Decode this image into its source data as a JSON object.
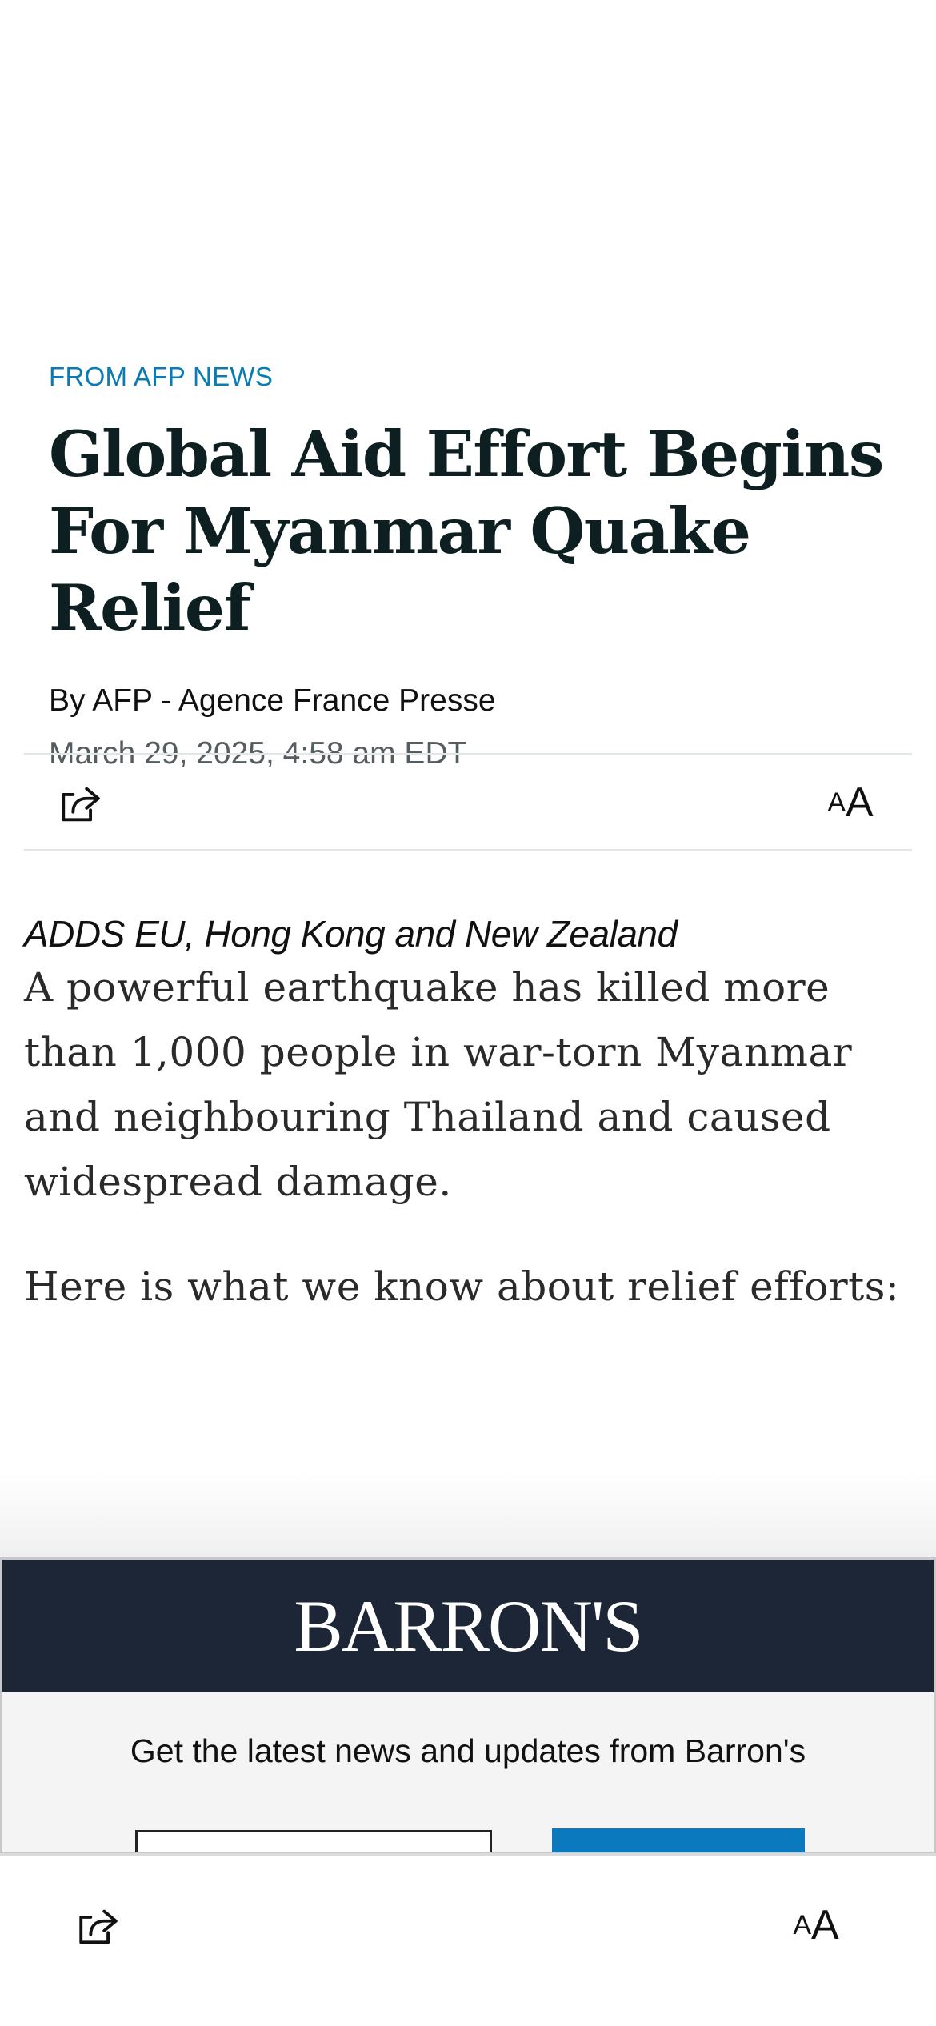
{
  "article": {
    "kicker": "FROM AFP NEWS",
    "headline": "Global Aid Effort Begins For Myanmar Quake Relief",
    "byline": "By AFP - Agence France Presse",
    "dateline": "March 29, 2025, 4:58 am EDT",
    "dek": "ADDS EU, Hong Kong and New Zealand",
    "paragraphs": [
      "A powerful earthquake has killed more than 1,000 people in war-torn Myanmar and neighbouring Thailand and caused widespread damage.",
      "Here is what we know about relief efforts:"
    ]
  },
  "toolbar": {
    "share_icon": "share-icon",
    "text_size": {
      "small": "A",
      "big": "A"
    }
  },
  "promo": {
    "brand": "BARRON'S",
    "text": "Get the latest news and updates from Barron's"
  },
  "colors": {
    "kicker": "#0a7cb5",
    "brand_bg": "#1c2636",
    "submit": "#0a79bd"
  }
}
